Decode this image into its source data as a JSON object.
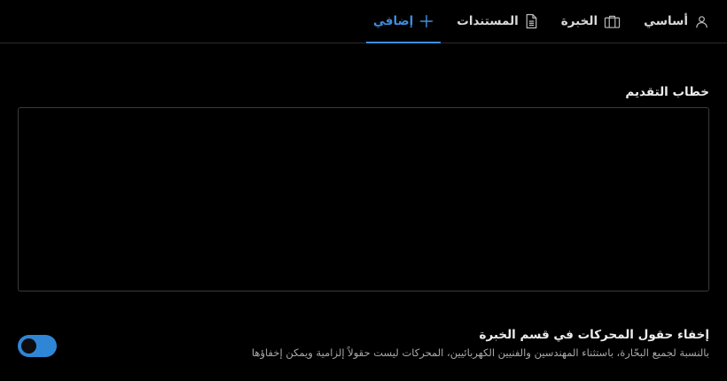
{
  "colors": {
    "background": "#000000",
    "accent": "#3d8fe0",
    "text": "#e6e6e6",
    "muted_text": "#a9a9a9",
    "border": "#3a3a3a",
    "toggle_on": "#2f86d6"
  },
  "tabs": [
    {
      "label": "أساسي",
      "icon": "user-icon",
      "active": false
    },
    {
      "label": "الخبرة",
      "icon": "briefcase-icon",
      "active": false
    },
    {
      "label": "المستندات",
      "icon": "document-icon",
      "active": false
    },
    {
      "label": "إضافي",
      "icon": "plus-icon",
      "active": true
    }
  ],
  "cover_letter": {
    "label": "خطاب التقديم",
    "value": ""
  },
  "hide_engines": {
    "title": "إخفاء حقول المحركات في قسم الخبرة",
    "description": "بالنسبة لجميع البحّارة، باستثناء المهندسين والفنيين الكهربائيين، المحركات ليست حقولاً إلزامية ويمكن إخفاؤها",
    "enabled": true
  }
}
